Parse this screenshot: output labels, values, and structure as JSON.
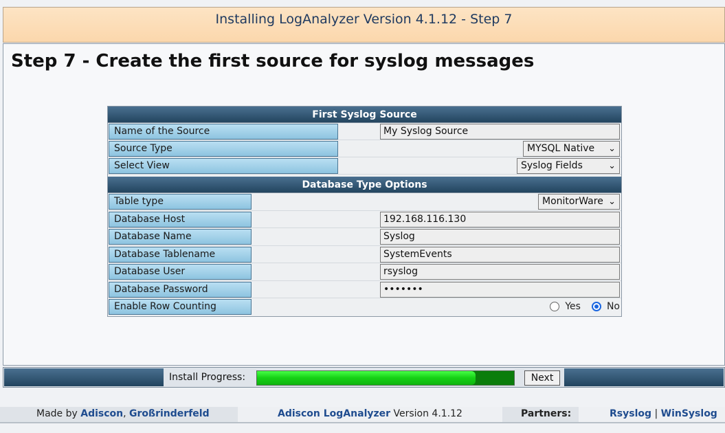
{
  "header": {
    "title": "Installing LogAnalyzer Version 4.1.12 - Step 7"
  },
  "page_title": "Step 7 - Create the first source for syslog messages",
  "syslog_source": {
    "section_title": "First Syslog Source",
    "name_label": "Name of the Source",
    "name_value": "My Syslog Source",
    "type_label": "Source Type",
    "type_value": "MYSQL Native",
    "view_label": "Select View",
    "view_value": "Syslog Fields"
  },
  "database_options": {
    "section_title": "Database Type Options",
    "table_type_label": "Table type",
    "table_type_value": "MonitorWare",
    "host_label": "Database Host",
    "host_value": "192.168.116.130",
    "name_label": "Database Name",
    "name_value": "Syslog",
    "tablename_label": "Database Tablename",
    "tablename_value": "SystemEvents",
    "user_label": "Database User",
    "user_value": "rsyslog",
    "password_label": "Database Password",
    "password_value": "•••••••",
    "row_counting_label": "Enable Row Counting",
    "row_counting_yes": "Yes",
    "row_counting_no": "No",
    "row_counting_selected": "No"
  },
  "progress": {
    "label": "Install Progress:",
    "fraction": 0.85,
    "next_label": "Next"
  },
  "footer": {
    "made_by": "Made by",
    "adiscon": "Adiscon",
    "comma": ",",
    "location": "Großrinderfeld",
    "product_link": "Adiscon LogAnalyzer",
    "version": "Version 4.1.12",
    "partners": "Partners:",
    "rsyslog": "Rsyslog",
    "sep": "|",
    "winsyslog": "WinSyslog"
  },
  "colors": {
    "header_bg": "#fbd7ac",
    "section_bg": "#23455f",
    "label_bg": "#8ec4e0",
    "progress_fill": "#15d015",
    "link": "#1f4c8f"
  }
}
